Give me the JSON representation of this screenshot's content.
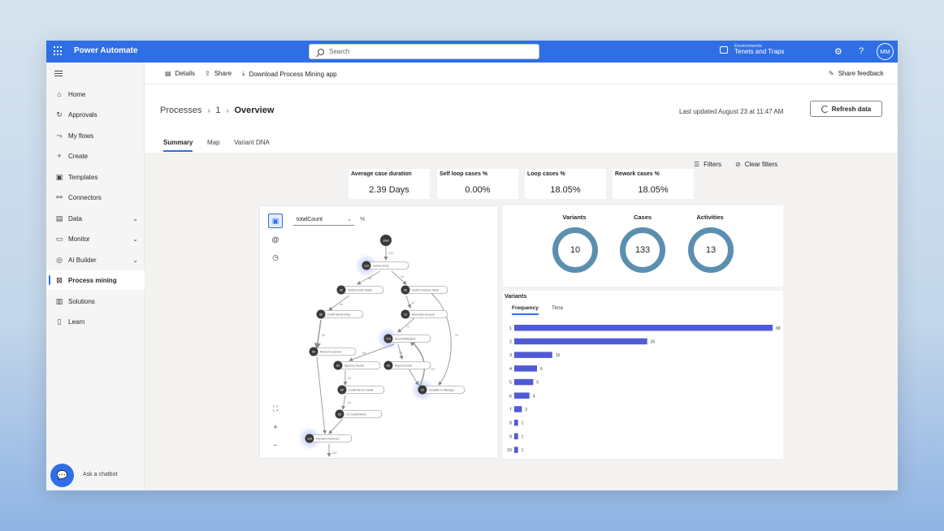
{
  "app": {
    "title": "Power Automate",
    "search_placeholder": "Search",
    "environment_label": "Environments",
    "environment_name": "Tenets and Traps",
    "user_initials": "MM"
  },
  "sidebar": {
    "items": [
      {
        "label": "Home",
        "icon": "home-icon",
        "glyph": "⌂"
      },
      {
        "label": "Approvals",
        "icon": "approvals-icon",
        "glyph": "↻"
      },
      {
        "label": "My flows",
        "icon": "flows-icon",
        "glyph": "⤳"
      },
      {
        "label": "Create",
        "icon": "plus-icon",
        "glyph": "+"
      },
      {
        "label": "Templates",
        "icon": "templates-icon",
        "glyph": "▣"
      },
      {
        "label": "Connectors",
        "icon": "connectors-icon",
        "glyph": "⚯"
      },
      {
        "label": "Data",
        "icon": "data-icon",
        "glyph": "▤"
      },
      {
        "label": "Monitor",
        "icon": "monitor-icon",
        "glyph": "▭"
      },
      {
        "label": "AI Builder",
        "icon": "ai-builder-icon",
        "glyph": "◎"
      },
      {
        "label": "Process mining",
        "icon": "process-mining-icon",
        "glyph": "⊠"
      },
      {
        "label": "Solutions",
        "icon": "solutions-icon",
        "glyph": "▥"
      },
      {
        "label": "Learn",
        "icon": "learn-icon",
        "glyph": "▯"
      }
    ],
    "chatbot_label": "Ask a chatbot"
  },
  "commandbar": {
    "details": "Details",
    "share": "Share",
    "download": "Download Process Mining app",
    "feedback": "Share feedback"
  },
  "header": {
    "breadcrumb_root": "Processes",
    "breadcrumb_mid": "1",
    "breadcrumb_current": "Overview",
    "last_updated": "Last updated August 23 at 11:47 AM",
    "refresh": "Refresh data",
    "tabs": [
      "Summary",
      "Map",
      "Variant DNA"
    ]
  },
  "filters": {
    "filters": "Filters",
    "clear": "Clear filters"
  },
  "kpis": [
    {
      "label": "Average case duration",
      "value": "2.39 Days"
    },
    {
      "label": "Self loop cases %",
      "value": "0.00%"
    },
    {
      "label": "Loop cases %",
      "value": "18.05%"
    },
    {
      "label": "Rework cases %",
      "value": "18.05%"
    }
  ],
  "map": {
    "metric": "totalCount",
    "pct": "%",
    "start": "Start",
    "edge_labels": [
      "133",
      "55",
      "43",
      "44",
      "14",
      "42",
      "77",
      "60",
      "35",
      "20",
      "63",
      "117",
      "12",
      "133"
    ],
    "nodes": [
      {
        "count": "133",
        "label": "Invoice Entry"
      },
      {
        "count": "66",
        "label": "Verify Invoice Match"
      },
      {
        "count": "66",
        "label": "Credit Memo Entry"
      },
      {
        "count": "66",
        "label": "Refund Customer"
      },
      {
        "count": "65",
        "label": "Approve Invoice"
      },
      {
        "count": "60",
        "label": "Credit Memo Create"
      },
      {
        "count": "63",
        "label": "CE Credit Memo"
      },
      {
        "count": "133",
        "label": "Payment Received"
      },
      {
        "count": "66",
        "label": "Verify Purchase Order"
      },
      {
        "count": "12",
        "label": "Reconcile Account"
      },
      {
        "count": "115",
        "label": "Send Notification"
      },
      {
        "count": "66",
        "label": "Reject Invoice"
      },
      {
        "count": "20",
        "label": "Escalate to Manager"
      }
    ]
  },
  "stats": {
    "variants_label": "Variants",
    "variants": "10",
    "cases_label": "Cases",
    "cases": "133",
    "activities_label": "Activities",
    "activities": "13",
    "color": "#5b8fb0"
  },
  "variants": {
    "title": "Variants",
    "tab_frequency": "Frequency",
    "tab_time": "Time",
    "bar_color": "#4f5bd5"
  },
  "chart_data": {
    "type": "bar",
    "orientation": "horizontal",
    "title": "Variants",
    "categories": [
      "1",
      "2",
      "3",
      "4",
      "5",
      "6",
      "7",
      "8",
      "9",
      "10"
    ],
    "values": [
      68,
      35,
      10,
      6,
      5,
      4,
      2,
      1,
      1,
      1
    ],
    "xlim": [
      0,
      68
    ],
    "grid": false
  }
}
